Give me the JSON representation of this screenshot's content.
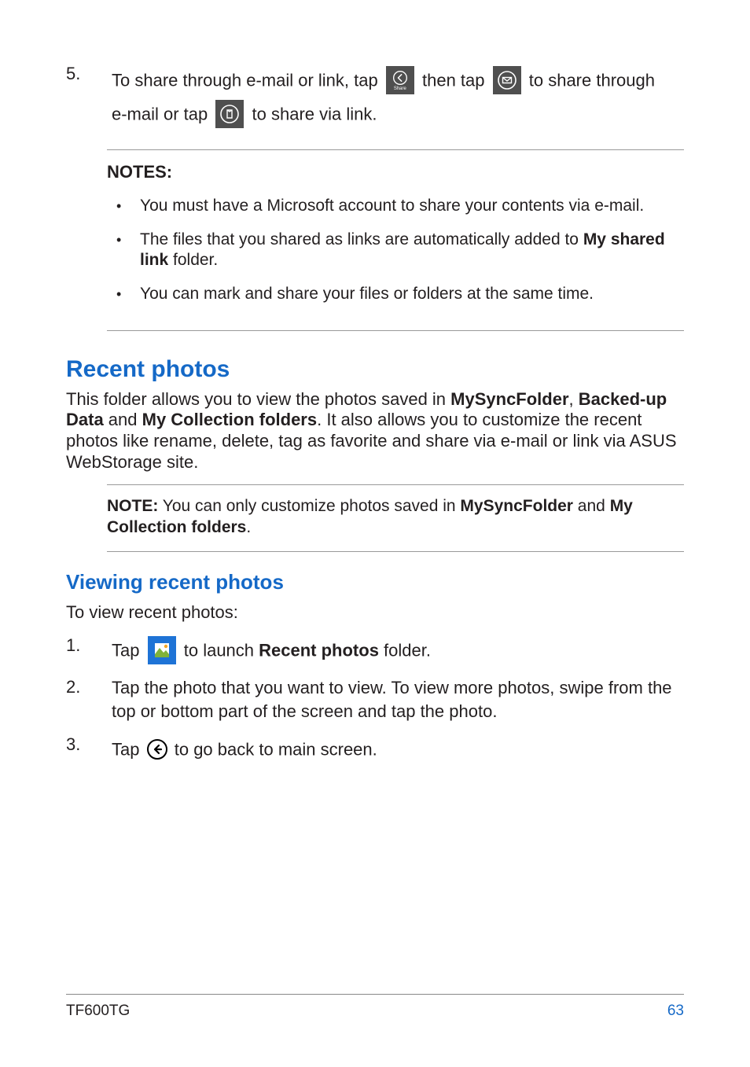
{
  "step5": {
    "num": "5.",
    "t1": "To share through e-mail or link, tap",
    "t2": "then tap",
    "t3": "to share through",
    "t4": "e-mail or tap",
    "t5": "to share via link.",
    "share_sub": "Share"
  },
  "notes1": {
    "title": "NOTES:",
    "items": [
      {
        "html": "You must have a Microsoft account to share your contents via e-mail."
      },
      {
        "pre": "The files that you shared as links are automatically added to ",
        "bold": "My shared link",
        "post": " folder."
      },
      {
        "html": "You can mark and share your files or folders at the same time."
      }
    ]
  },
  "recent": {
    "heading": "Recent photos",
    "p_pre": "This folder allows you to view the photos saved in ",
    "b1": "MySyncFolder",
    "sep1": ", ",
    "b2": "Backed-up Data",
    "mid": " and ",
    "b3": "My Collection folders",
    "p_post": ". It also allows you to customize the recent photos like rename, delete, tag as favorite and share via e-mail or link via ASUS WebStorage site."
  },
  "note2": {
    "label": "NOTE:",
    "pre": "  You can only customize photos saved in ",
    "b1": "MySyncFolder",
    "mid": " and ",
    "b2": "My Collection folders",
    "post": "."
  },
  "viewing": {
    "heading": "Viewing recent photos",
    "intro": "To view recent photos:",
    "s1": {
      "num": "1.",
      "t1": "Tap",
      "t2": "to launch ",
      "bold": "Recent photos",
      "t3": " folder."
    },
    "s2": {
      "num": "2.",
      "text": "Tap the photo that you want to view. To view more photos, swipe from the top or bottom part of the screen and tap the photo."
    },
    "s3": {
      "num": "3.",
      "t1": "Tap",
      "t2": "to go back to main screen."
    }
  },
  "footer": {
    "model": "TF600TG",
    "page": "63"
  }
}
